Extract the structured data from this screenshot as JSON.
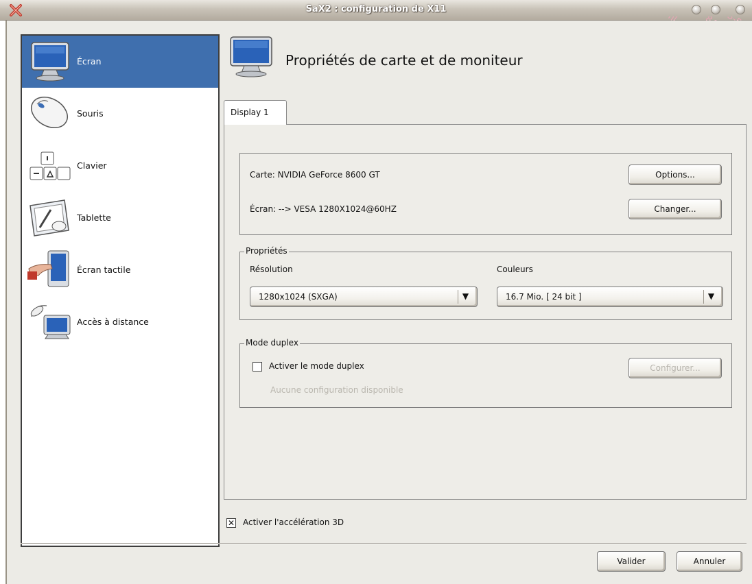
{
  "window": {
    "title": "SaX2 : configuration de X11"
  },
  "sidebar": {
    "items": [
      {
        "label": "Écran",
        "icon": "monitor-icon"
      },
      {
        "label": "Souris",
        "icon": "mouse-icon"
      },
      {
        "label": "Clavier",
        "icon": "keyboard-icon"
      },
      {
        "label": "Tablette",
        "icon": "tablet-icon"
      },
      {
        "label": "Écran tactile",
        "icon": "touchscreen-icon"
      },
      {
        "label": "Accès à distance",
        "icon": "remote-access-icon"
      }
    ],
    "active_index": 0
  },
  "header": {
    "title": "Propriétés de carte et de moniteur",
    "icon": "monitor-icon"
  },
  "tabs": [
    {
      "label": "Display 1"
    }
  ],
  "device": {
    "card_label": "Carte: NVIDIA GeForce 8600 GT",
    "screen_label": "Écran: --> VESA 1280X1024@60HZ",
    "options_button": "Options...",
    "change_button": "Changer..."
  },
  "properties": {
    "group_title": "Propriétés",
    "resolution_label": "Résolution",
    "resolution_value": "1280x1024 (SXGA)",
    "colors_label": "Couleurs",
    "colors_value": "16.7 Mio. [ 24 bit ]"
  },
  "duplex": {
    "group_title": "Mode duplex",
    "checkbox_label": "Activer le mode duplex",
    "checked": false,
    "configure_button": "Configurer...",
    "hint": "Aucune configuration disponible"
  },
  "acceleration": {
    "label": "Activer l'accélération 3D",
    "checked": true,
    "check_glyph": "✕"
  },
  "footer": {
    "ok_button": "Valider",
    "cancel_button": "Annuler"
  },
  "watermark": {
    "lines": [
      "ml - 593c47e2-e75d-4",
      "- 593c47e2-e75d-4846-a855",
      "e75d-4846-a855-50",
      "846-a855-5d7f",
      "3-5d7f"
    ]
  },
  "colors": {
    "selection": "#3f6fae",
    "window_bg": "#ecebe6",
    "watermark": "#e7a5b5"
  }
}
